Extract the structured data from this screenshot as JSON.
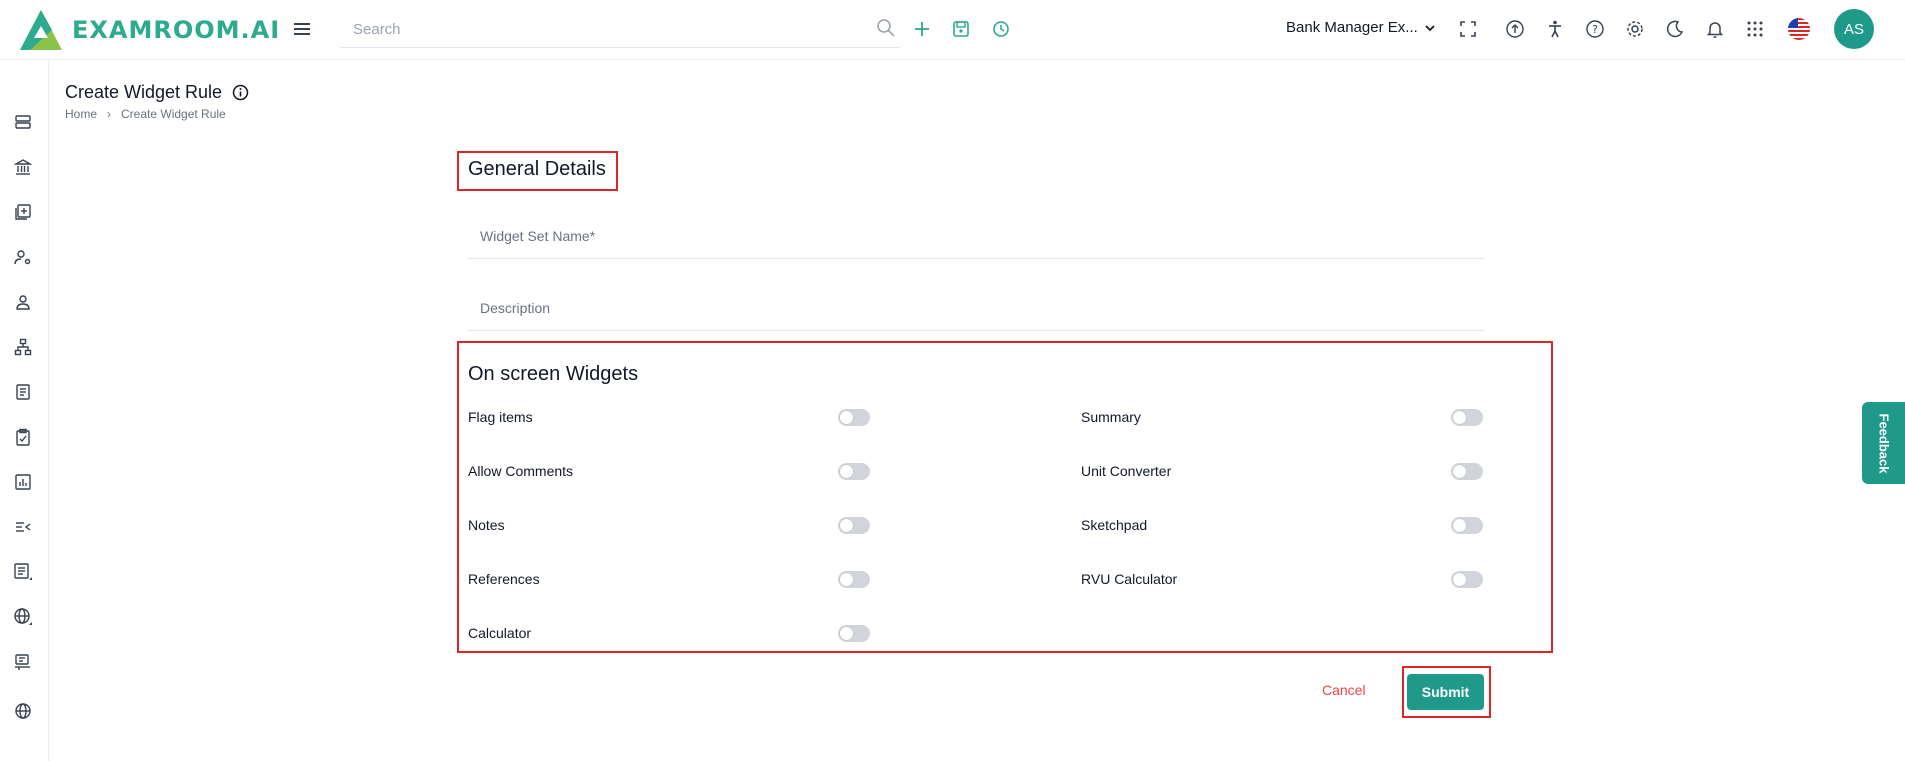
{
  "header": {
    "logo_text": "EXAMROOM.AI",
    "search_placeholder": "Search",
    "bank_selector": "Bank Manager Ex...",
    "avatar_initials": "AS"
  },
  "page": {
    "title": "Create Widget Rule",
    "breadcrumb": {
      "home": "Home",
      "separator": "›",
      "current": "Create Widget Rule"
    }
  },
  "general_details": {
    "title": "General Details",
    "widget_set_name_placeholder": "Widget Set Name*",
    "description_placeholder": "Description"
  },
  "widgets": {
    "title": "On screen Widgets",
    "left": [
      {
        "label": "Flag items",
        "on": false
      },
      {
        "label": "Allow Comments",
        "on": false
      },
      {
        "label": "Notes",
        "on": false
      },
      {
        "label": "References",
        "on": false
      },
      {
        "label": "Calculator",
        "on": false
      }
    ],
    "right": [
      {
        "label": "Summary",
        "on": false
      },
      {
        "label": "Unit Converter",
        "on": false
      },
      {
        "label": "Sketchpad",
        "on": false
      },
      {
        "label": "RVU Calculator",
        "on": false
      }
    ]
  },
  "actions": {
    "cancel": "Cancel",
    "submit": "Submit"
  },
  "feedback_label": "Feedback",
  "colors": {
    "accent": "#1f9a8a",
    "highlight": "#dc2626",
    "cancel": "#ef4444"
  }
}
